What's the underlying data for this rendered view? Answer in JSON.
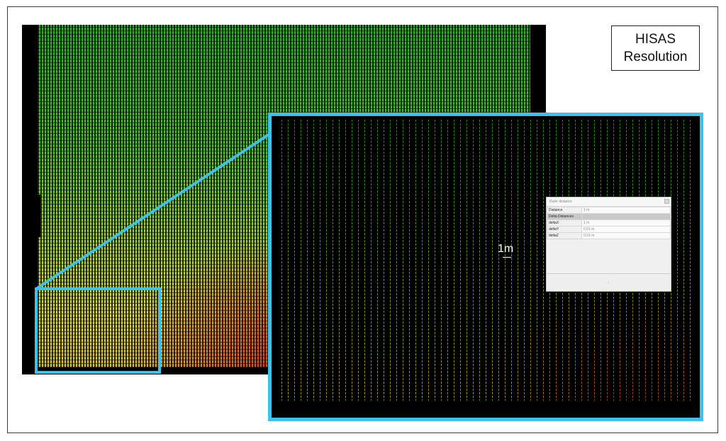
{
  "caption": {
    "line1": "HISAS",
    "line2": "Resolution"
  },
  "zoom": {
    "scale_label": "1m"
  },
  "ruler_panel": {
    "title": "Ruler distance",
    "rows": [
      {
        "key": "Distance",
        "value": "1 m"
      },
      {
        "key": "Delta Distances",
        "value": ""
      },
      {
        "key": "deltaX",
        "value": "1 m"
      },
      {
        "key": "deltaY",
        "value": "0.01 m"
      },
      {
        "key": "deltaZ",
        "value": "0.01 m"
      }
    ],
    "footer": "..."
  },
  "colors": {
    "highlight": "#3ec1ea"
  }
}
